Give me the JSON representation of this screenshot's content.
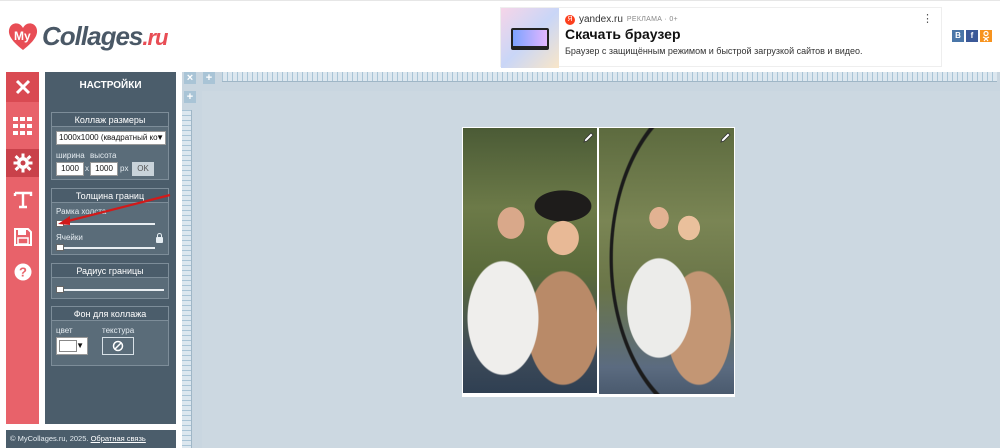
{
  "logo": {
    "my": "My",
    "text": "Collages",
    "tld": ".ru"
  },
  "ad": {
    "source": "yandex.ru",
    "marker": "РЕКЛАМА · 0+",
    "title": "Скачать браузер",
    "description": "Браузер с защищённым режимом и быстрой загрузкой сайтов и видео."
  },
  "socials": [
    {
      "name": "В"
    },
    {
      "name": "f"
    },
    {
      "name": "ok"
    }
  ],
  "panel": {
    "title": "НАСТРОЙКИ",
    "size_box": {
      "title": "Коллаж размеры",
      "selected": "1000x1000 (квадратный ко",
      "width_label": "ширина",
      "height_label": "высота",
      "width": "1000",
      "height": "1000",
      "x": "x",
      "unit": "px",
      "ok": "OK"
    },
    "border_box": {
      "title": "Толщина границ",
      "frame_label": "Рамка холста",
      "cells_label": "Ячейки",
      "frame_value": 0,
      "cells_value": 0
    },
    "radius_box": {
      "title": "Радиус границы",
      "value": 0
    },
    "bg_box": {
      "title": "Фон для коллажа",
      "color_label": "цвет",
      "texture_label": "текстура",
      "color": "#ffffff"
    }
  },
  "footer": {
    "copyright": "© MyCollages.ru, 2025.",
    "feedback": "Обратная связь"
  },
  "colors": {
    "accent": "#e8626a",
    "panel": "#4b5d6b",
    "workarea": "#ccd8e1",
    "ruler": "#a9c4d6"
  }
}
